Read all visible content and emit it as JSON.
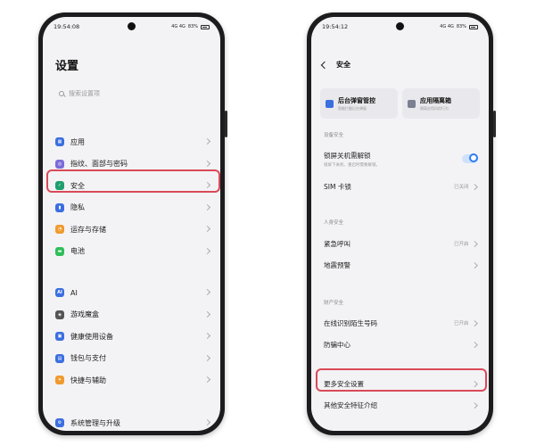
{
  "left_phone": {
    "status": {
      "time": "19:54:08",
      "signal": "4G 4G",
      "battery": "83%"
    },
    "title": "设置",
    "search": {
      "placeholder": "搜索设置项"
    },
    "group1": [
      {
        "label": "应用",
        "icon": "grid-icon",
        "color": "#3b6fe0",
        "glyph": "▦"
      },
      {
        "label": "指纹、面部与密码",
        "icon": "fingerprint-icon",
        "color": "#7a6cd8",
        "glyph": "◎"
      },
      {
        "label": "安全",
        "icon": "shield-icon",
        "color": "#1f9e6e",
        "glyph": "✓"
      },
      {
        "label": "隐私",
        "icon": "privacy-icon",
        "color": "#3b6fe0",
        "glyph": "▮"
      },
      {
        "label": "运存与存储",
        "icon": "storage-icon",
        "color": "#f09a2e",
        "glyph": "◔"
      },
      {
        "label": "电池",
        "icon": "battery-icon",
        "color": "#2fbf5a",
        "glyph": "▬"
      }
    ],
    "group2": [
      {
        "label": "AI",
        "icon": "ai-icon",
        "color": "#3b6fe0",
        "glyph": "AI"
      },
      {
        "label": "游戏魔盒",
        "icon": "gamepad-icon",
        "color": "#555555",
        "glyph": "◈"
      },
      {
        "label": "健康使用设备",
        "icon": "health-icon",
        "color": "#3b6fe0",
        "glyph": "▣"
      },
      {
        "label": "钱包与支付",
        "icon": "wallet-icon",
        "color": "#3b6fe0",
        "glyph": "▤"
      },
      {
        "label": "快捷与辅助",
        "icon": "shortcut-icon",
        "color": "#f09a2e",
        "glyph": "✦"
      }
    ],
    "group3": [
      {
        "label": "系统管理与升级",
        "icon": "system-icon",
        "color": "#3b6fe0",
        "glyph": "⚙"
      }
    ]
  },
  "right_phone": {
    "status": {
      "time": "19:54:12",
      "signal": "4G 4G",
      "battery": "83%"
    },
    "header_title": "安全",
    "cards": [
      {
        "title": "后台弹窗管控",
        "sub": "智能拦截后台弹窗",
        "icon": "popup-block-icon",
        "color": "#3b6fe0"
      },
      {
        "title": "应用隔离箱",
        "sub": "隔离应用风险行为",
        "icon": "isolation-box-icon",
        "color": "#7b8190"
      }
    ],
    "sections": {
      "device": "设备安全",
      "personal": "人身安全",
      "property": "财产安全"
    },
    "rows": {
      "lock_reboot": {
        "label": "锁屏关机需解锁",
        "sub": "锁屏下关机、重启时需要解锁。"
      },
      "sim_lock": {
        "label": "SIM 卡锁",
        "value": "已关闭"
      },
      "emergency": {
        "label": "紧急呼叫",
        "value": "已开启"
      },
      "quake": {
        "label": "地震预警",
        "value": ""
      },
      "stranger": {
        "label": "在线识别陌生号码",
        "value": "已开启"
      },
      "fraud": {
        "label": "防骗中心",
        "value": ""
      },
      "more": {
        "label": "更多安全设置",
        "value": ""
      },
      "other": {
        "label": "其他安全特征介绍",
        "value": ""
      }
    }
  },
  "colors": {
    "highlight": "#d94a58",
    "toggle_on": "#2f7df6"
  }
}
